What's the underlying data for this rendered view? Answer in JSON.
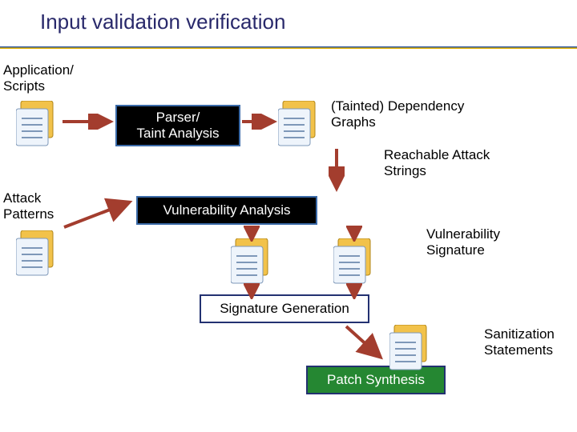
{
  "title": "Input validation verification",
  "labels": {
    "app_scripts": "Application/\nScripts",
    "attack_patterns": "Attack\nPatterns",
    "dep_graphs": "(Tainted) Dependency\nGraphs",
    "reachable": "Reachable Attack\nStrings",
    "vuln_sig": "Vulnerability\nSignature",
    "san_stmts": "Sanitization\nStatements"
  },
  "boxes": {
    "parser": "Parser/\nTaint Analysis",
    "vuln_analysis": "Vulnerability Analysis",
    "sig_gen": "Signature Generation",
    "patch_synth": "Patch Synthesis"
  }
}
